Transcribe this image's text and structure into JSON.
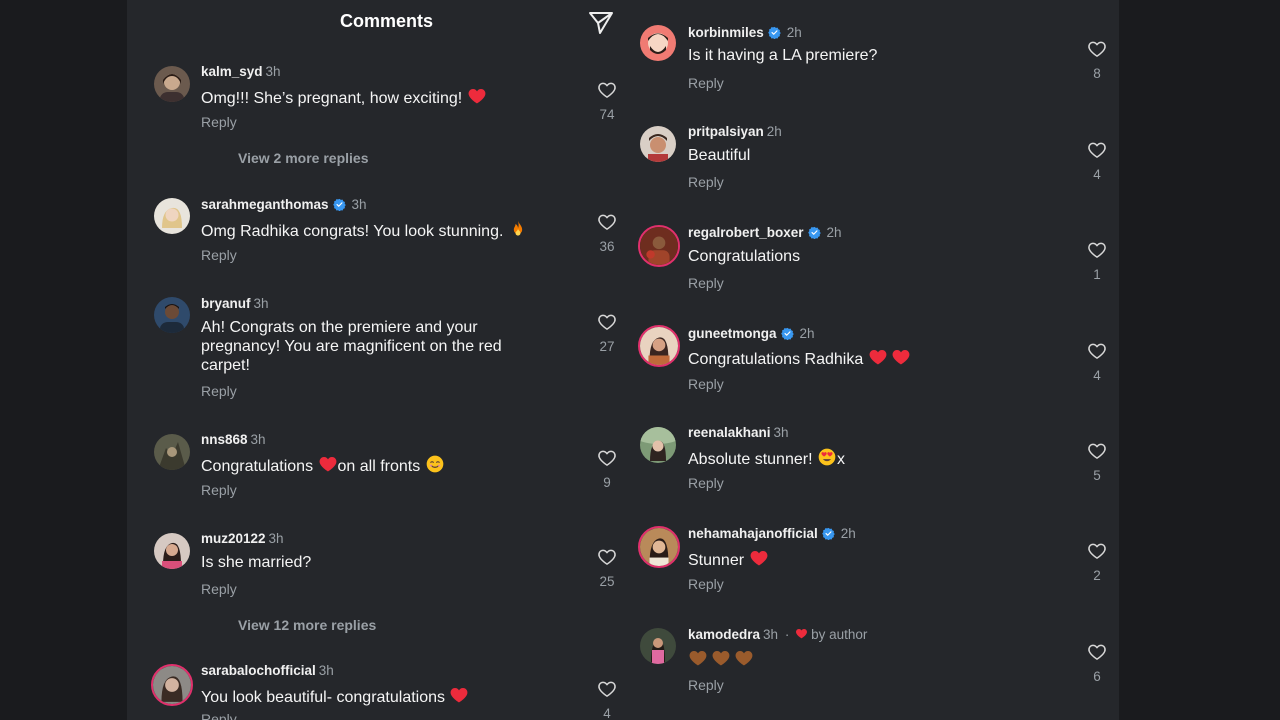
{
  "header": {
    "title": "Comments"
  },
  "left": [
    {
      "username": "kalm_syd",
      "time": "3h",
      "text": "Omg!!! She’s pregnant, how exciting!",
      "likes": "74",
      "reply": "Reply",
      "more": "View 2 more replies"
    },
    {
      "username": "sarahmeganthomas",
      "time": "3h",
      "text": "Omg Radhika congrats! You look stunning.",
      "likes": "36",
      "reply": "Reply"
    },
    {
      "username": "bryanuf",
      "time": "3h",
      "text_lines": [
        "Ah! Congrats on the premiere and your",
        "pregnancy! You are magnificent on the red",
        "carpet!"
      ],
      "likes": "27",
      "reply": "Reply"
    },
    {
      "username": "nns868",
      "time": "3h",
      "text_a": "Congratulations",
      "text_b": "on all fronts",
      "likes": "9",
      "reply": "Reply"
    },
    {
      "username": "muz20122",
      "time": "3h",
      "text": "Is she married?",
      "likes": "25",
      "reply": "Reply",
      "more": "View 12 more replies"
    },
    {
      "username": "sarabalochofficial",
      "time": "3h",
      "text": "You look beautiful- congratulations",
      "likes": "4",
      "reply": "Reply"
    }
  ],
  "right": [
    {
      "username": "korbinmiles",
      "time": "2h",
      "text": "Is it having a LA premiere?",
      "likes": "8",
      "reply": "Reply"
    },
    {
      "username": "pritpalsiyan",
      "time": "2h",
      "text": "Beautiful",
      "likes": "4",
      "reply": "Reply"
    },
    {
      "username": "regalrobert_boxer",
      "time": "2h",
      "text": "Congratulations",
      "likes": "1",
      "reply": "Reply"
    },
    {
      "username": "guneetmonga",
      "time": "2h",
      "text": "Congratulations Radhika",
      "likes": "4",
      "reply": "Reply"
    },
    {
      "username": "reenalakhani",
      "time": "3h",
      "text": "Absolute stunner!",
      "text_suffix": "x",
      "likes": "5",
      "reply": "Reply"
    },
    {
      "username": "nehamahajanofficial",
      "time": "2h",
      "text": "Stunner",
      "likes": "2",
      "reply": "Reply"
    },
    {
      "username": "kamodedra",
      "time": "3h",
      "by_author": "by author",
      "likes": "6",
      "reply": "Reply"
    }
  ],
  "icons": {
    "share": "paper-plane-icon",
    "like": "heart-outline-icon",
    "verified": "verified-badge-icon",
    "emoji_heart": "red-heart-emoji",
    "emoji_fire": "fire-emoji",
    "emoji_smile": "smiling-face-emoji",
    "emoji_heart_eyes": "heart-eyes-emoji",
    "emoji_brown_heart": "brown-heart-emoji"
  },
  "colors": {
    "background": "#25272b",
    "outer_background": "#1a1b1e",
    "text": "#f5f5f5",
    "muted": "#9aa0a6",
    "verified": "#3897f0",
    "heart": "#ed2b3c",
    "story_ring": "#e1306c"
  }
}
